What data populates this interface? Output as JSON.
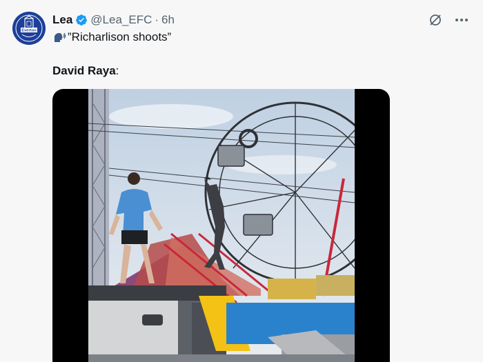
{
  "tweet": {
    "display_name": "Lea",
    "handle": "@Lea_EFC",
    "separator": "·",
    "time": "6h",
    "text": "”Richarlison shoots”",
    "text_icon": "speaking-head-icon",
    "reply_name": "David Raya",
    "reply_colon": ":"
  },
  "avatar": {
    "label": "Everton",
    "colors": {
      "brand": "#1d3f9a"
    }
  },
  "actions": {
    "icons": [
      "grok-icon",
      "more-icon"
    ]
  },
  "colors": {
    "verified": "#1d9bf0",
    "secondary_text": "#536471"
  }
}
